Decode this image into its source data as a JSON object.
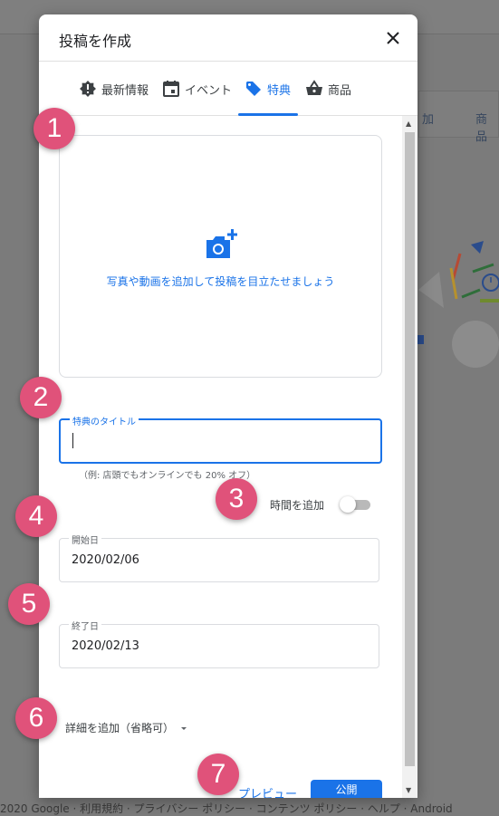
{
  "background": {
    "card_label_left": "加",
    "card_label_right": "商品",
    "footer": "2020 Google  ·  利用規約  ·  プライバシー ポリシー  ·  コンテンツ ポリシー  ·  ヘルプ  ·  Android"
  },
  "dialog": {
    "title": "投稿を作成",
    "close_icon": "close-icon"
  },
  "tabs": [
    {
      "label": "最新情報",
      "icon": "alert-icon",
      "active": false
    },
    {
      "label": "イベント",
      "icon": "calendar-icon",
      "active": false
    },
    {
      "label": "特典",
      "icon": "tag-icon",
      "active": true
    },
    {
      "label": "商品",
      "icon": "basket-icon",
      "active": false
    }
  ],
  "media": {
    "icon": "add-photo-icon",
    "text": "写真や動画を追加して投稿を目立たせましょう"
  },
  "offer_title": {
    "label": "特典のタイトル",
    "value": "",
    "hint": "（例: 店頭でもオンラインでも 20% オフ）"
  },
  "time": {
    "label": "時間を追加",
    "enabled": false
  },
  "start_date": {
    "label": "開始日",
    "value": "2020/02/06"
  },
  "end_date": {
    "label": "終了日",
    "value": "2020/02/13"
  },
  "details": {
    "label": "詳細を追加（省略可）"
  },
  "actions": {
    "preview": "プレビュー",
    "publish": "公開"
  },
  "badges": [
    "1",
    "2",
    "3",
    "4",
    "5",
    "6",
    "7"
  ],
  "colors": {
    "accent": "#1a73e8",
    "badge": "#e0527a"
  }
}
